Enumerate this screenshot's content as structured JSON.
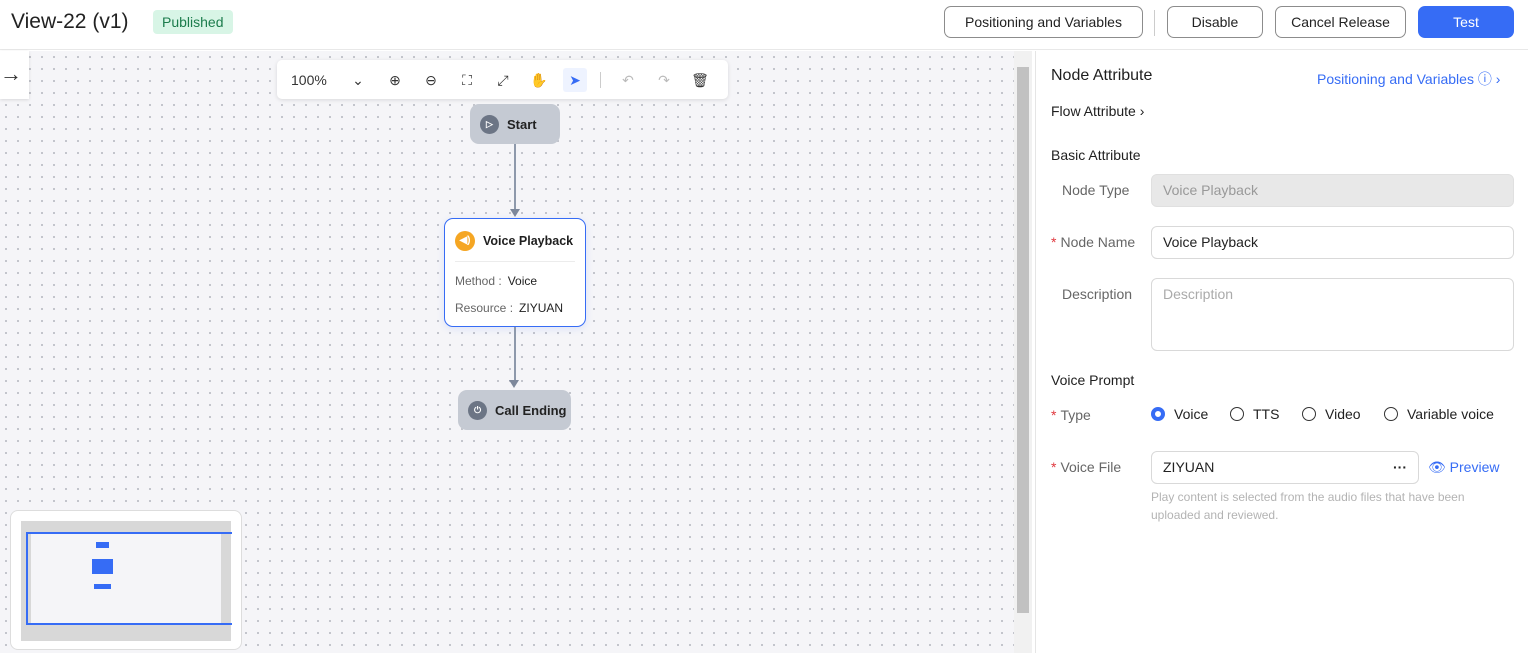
{
  "header": {
    "title": "View-22 (v1)",
    "status": "Published",
    "buttons": {
      "positioning": "Positioning and Variables",
      "disable": "Disable",
      "cancel_release": "Cancel Release",
      "test": "Test"
    }
  },
  "toolbar": {
    "zoom": "100%"
  },
  "flow": {
    "nodes": {
      "start": "Start",
      "voice": {
        "title": "Voice Playback",
        "method_label": "Method :",
        "method_value": "Voice",
        "resource_label": "Resource :",
        "resource_value": "ZIYUAN"
      },
      "end": "Call Ending"
    }
  },
  "panel": {
    "title": "Node Attribute",
    "positioning_link": "Positioning and Variables",
    "flow_attribute": "Flow Attribute",
    "basic_attribute": "Basic Attribute",
    "node_type_label": "Node Type",
    "node_type_value": "Voice Playback",
    "node_name_label": "Node Name",
    "node_name_value": "Voice Playback",
    "description_label": "Description",
    "description_placeholder": "Description",
    "voice_prompt": "Voice Prompt",
    "type_label": "Type",
    "type_options": [
      "Voice",
      "TTS",
      "Video",
      "Variable voice"
    ],
    "type_selected": "Voice",
    "voice_file_label": "Voice File",
    "voice_file_value": "ZIYUAN",
    "preview": "Preview",
    "hint": "Play content is selected from the audio files that have been uploaded and reviewed."
  },
  "colors": {
    "accent": "#366cf5",
    "published_bg": "#d8f5e6"
  }
}
